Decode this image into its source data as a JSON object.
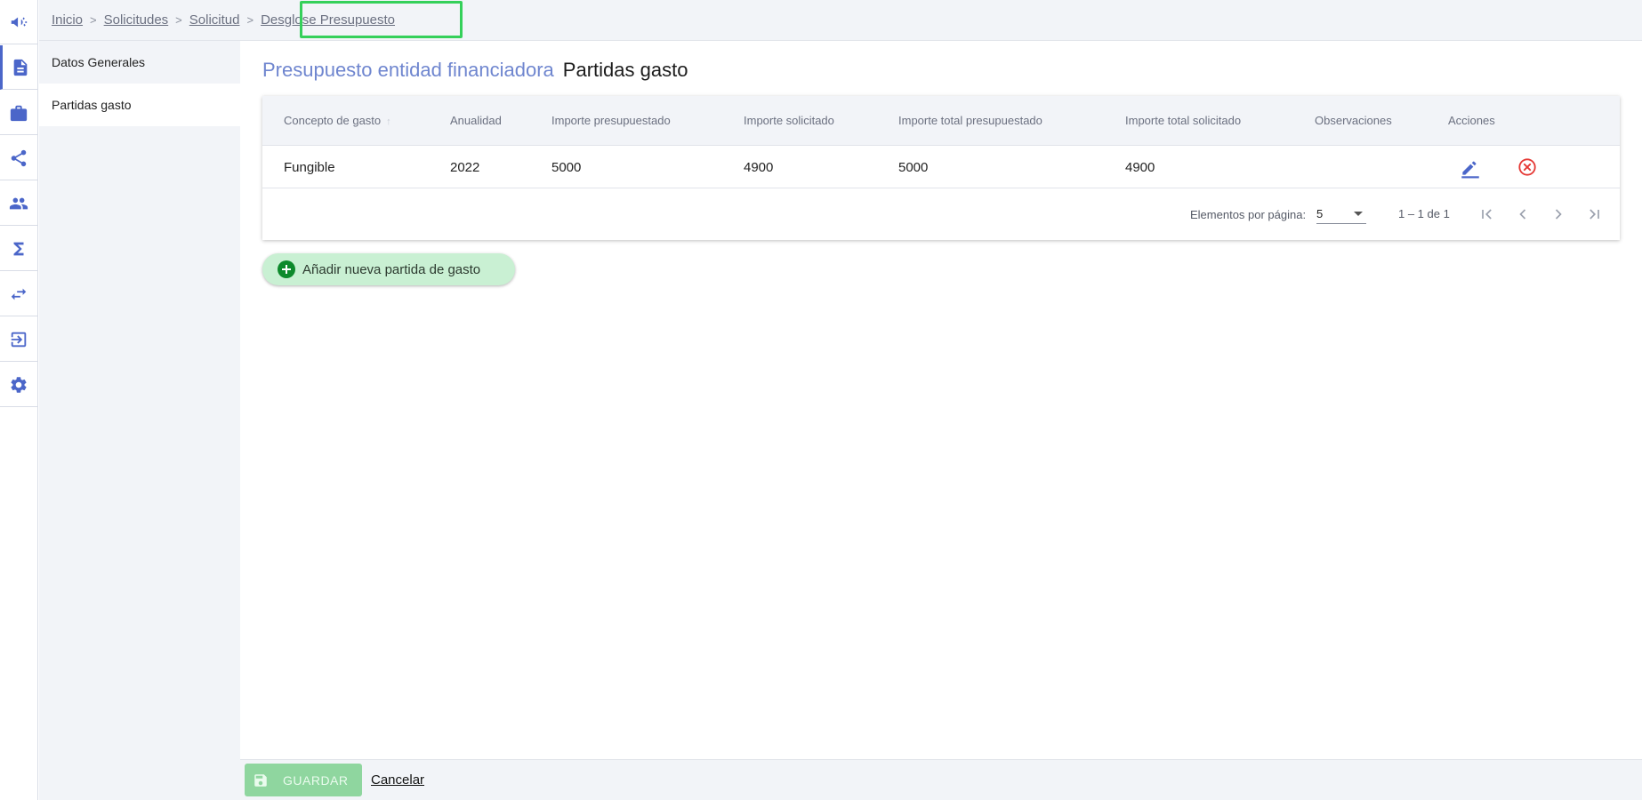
{
  "rail": {
    "items": [
      {
        "icon": "megaphone-icon"
      },
      {
        "icon": "document-icon"
      },
      {
        "icon": "briefcase-icon"
      },
      {
        "icon": "share-icon"
      },
      {
        "icon": "people-icon"
      },
      {
        "icon": "sigma-icon"
      },
      {
        "icon": "swap-arrows-icon"
      },
      {
        "icon": "logout-icon"
      },
      {
        "icon": "gear-icon"
      }
    ]
  },
  "breadcrumb": {
    "items": [
      "Inicio",
      "Solicitudes",
      "Solicitud",
      "Desglose Presupuesto"
    ]
  },
  "leftnav": {
    "items": [
      {
        "label": "Datos Generales"
      },
      {
        "label": "Partidas gasto"
      }
    ]
  },
  "main": {
    "title_prefix": "Presupuesto entidad financiadora",
    "title_suffix": "Partidas gasto",
    "table": {
      "columns": [
        "Concepto de gasto",
        "Anualidad",
        "Importe presupuestado",
        "Importe solicitado",
        "Importe total presupuestado",
        "Importe total solicitado",
        "Observaciones",
        "Acciones"
      ],
      "rows": [
        {
          "concepto": "Fungible",
          "anualidad": "2022",
          "importe_presupuestado": "5000",
          "importe_solicitado": "4900",
          "total_presupuestado": "5000",
          "total_solicitado": "4900",
          "observaciones": ""
        }
      ]
    },
    "paginator": {
      "items_per_page_label": "Elementos por página:",
      "items_per_page_value": "5",
      "range_label": "1 – 1 de 1"
    },
    "add_button_label": "Añadir nueva partida de gasto"
  },
  "footer": {
    "save_label": "GUARDAR",
    "cancel_label": "Cancelar"
  },
  "colors": {
    "accent": "#4b66c9",
    "title_accent": "#6f86cf",
    "add_button_bg": "#c9f0d3",
    "save_button_bg": "#8fd69f",
    "delete_red": "#e53935",
    "highlight_green": "#35d05a"
  }
}
